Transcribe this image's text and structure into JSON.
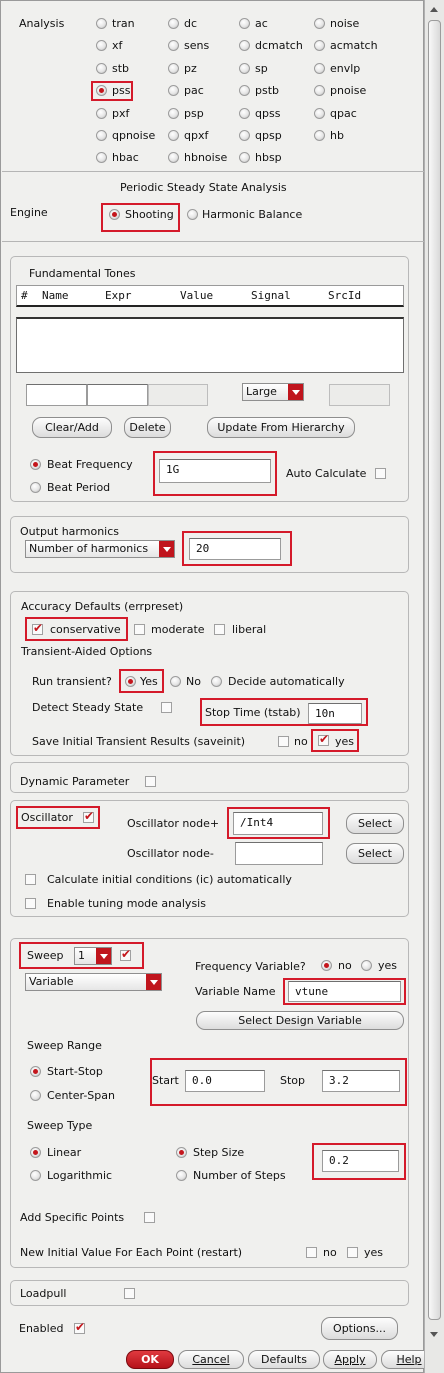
{
  "analysis": {
    "label": "Analysis",
    "options": [
      "tran",
      "dc",
      "ac",
      "noise",
      "xf",
      "sens",
      "dcmatch",
      "acmatch",
      "stb",
      "pz",
      "sp",
      "envlp",
      "pss",
      "pac",
      "pstb",
      "pnoise",
      "pxf",
      "psp",
      "qpss",
      "qpac",
      "qpnoise",
      "qpxf",
      "qpsp",
      "hb",
      "hbac",
      "hbnoise",
      "hbsp"
    ],
    "selected": "pss"
  },
  "pss": {
    "title": "Periodic Steady State Analysis",
    "engine_label": "Engine",
    "engine_shooting": "Shooting",
    "engine_hb": "Harmonic Balance"
  },
  "tones": {
    "title": "Fundamental Tones",
    "columns": [
      "#",
      "Name",
      "Expr",
      "Value",
      "Signal",
      "SrcId"
    ],
    "size_select": "Large",
    "btn_clear": "Clear/Add",
    "btn_delete": "Delete",
    "btn_update": "Update From Hierarchy",
    "beat_freq_label": "Beat Frequency",
    "beat_period_label": "Beat Period",
    "beat_value": "1G",
    "auto_calc_label": "Auto Calculate"
  },
  "harmonics": {
    "title": "Output harmonics",
    "select": "Number of harmonics",
    "value": "20"
  },
  "accuracy": {
    "title": "Accuracy Defaults (errpreset)",
    "conservative": "conservative",
    "moderate": "moderate",
    "liberal": "liberal",
    "transient_title": "Transient-Aided Options",
    "run_transient_label": "Run transient?",
    "yes": "Yes",
    "no": "No",
    "decide": "Decide automatically",
    "detect_label": "Detect Steady State",
    "stop_time_label": "Stop Time (tstab)",
    "stop_time_value": "10n",
    "save_label": "Save Initial Transient Results (saveinit)",
    "save_no": "no",
    "save_yes": "yes"
  },
  "dynamic": {
    "label": "Dynamic Parameter"
  },
  "oscillator": {
    "label": "Oscillator",
    "node_plus_label": "Oscillator node+",
    "node_plus_value": "/Int4",
    "node_minus_label": "Oscillator node-",
    "select_btn": "Select",
    "ic_label": "Calculate initial conditions (ic) automatically",
    "tuning_label": "Enable tuning mode analysis"
  },
  "sweep": {
    "label": "Sweep",
    "count": "1",
    "variable_select": "Variable",
    "freq_var_label": "Frequency Variable?",
    "freq_no": "no",
    "freq_yes": "yes",
    "var_name_label": "Variable Name",
    "var_name_value": "vtune",
    "select_design_var": "Select Design Variable",
    "range_title": "Sweep Range",
    "start_stop": "Start-Stop",
    "center_span": "Center-Span",
    "start_label": "Start",
    "start_value": "0.0",
    "stop_label": "Stop",
    "stop_value": "3.2",
    "type_title": "Sweep Type",
    "linear": "Linear",
    "logarithmic": "Logarithmic",
    "step_size": "Step Size",
    "num_steps": "Number of Steps",
    "step_value": "0.2",
    "add_points": "Add Specific Points",
    "restart_label": "New Initial Value For Each Point (restart)",
    "restart_no": "no",
    "restart_yes": "yes"
  },
  "loadpull": {
    "label": "Loadpull"
  },
  "footer": {
    "enabled": "Enabled",
    "options_btn": "Options...",
    "ok": "OK",
    "cancel": "Cancel",
    "defaults": "Defaults",
    "apply": "Apply",
    "help": "Help"
  },
  "colors": {
    "accent": "#c4161c",
    "highlight": "#d41a2a",
    "panel": "#f0f0ee"
  }
}
